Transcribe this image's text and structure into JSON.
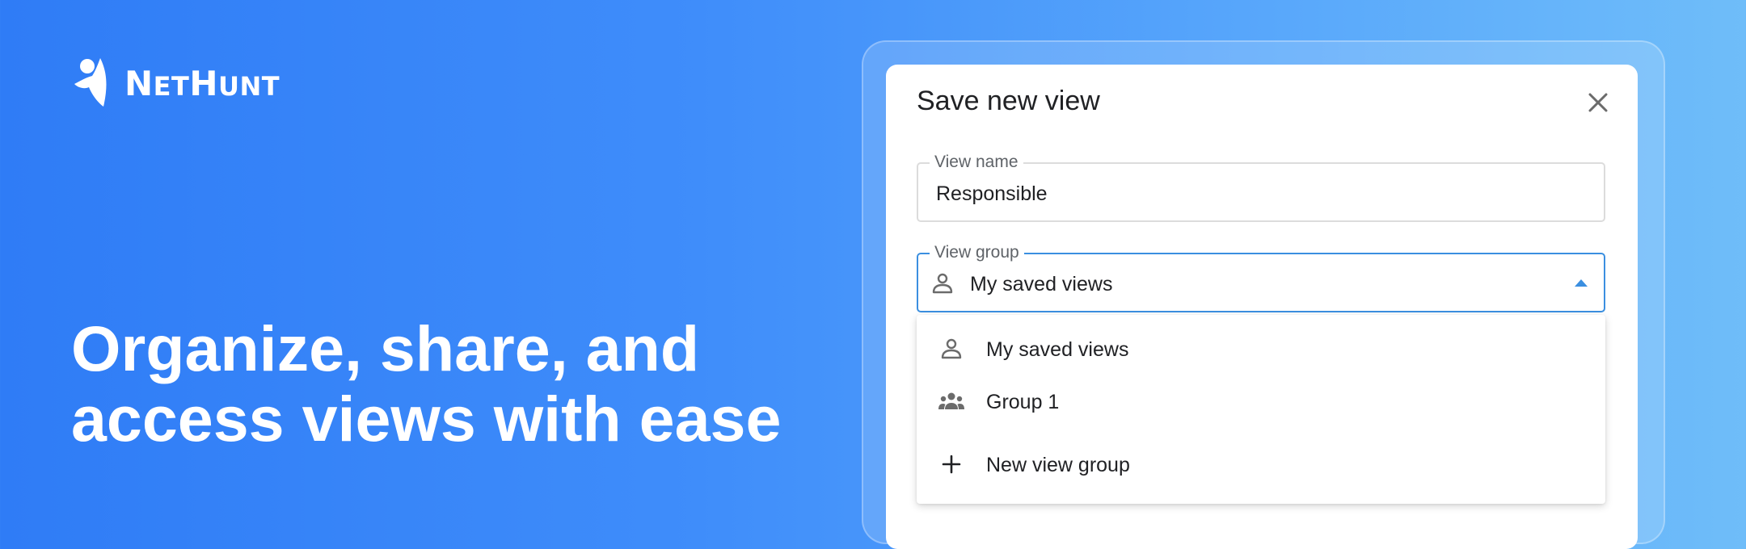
{
  "brand": {
    "name_initial_1": "N",
    "name_rest_1": "ET",
    "name_initial_2": "H",
    "name_rest_2": "UNT"
  },
  "headline": {
    "line1": "Organize, share, and",
    "line2": "access views with ease"
  },
  "dialog": {
    "title": "Save new view",
    "view_name": {
      "label": "View name",
      "value": "Responsible"
    },
    "view_group": {
      "label": "View group",
      "value": "My saved views"
    },
    "menu": [
      {
        "label": "My saved views",
        "icon": "person-icon"
      },
      {
        "label": "Group 1",
        "icon": "group-icon"
      },
      {
        "label": "New view group",
        "icon": "plus-icon"
      }
    ]
  },
  "colors": {
    "gradient_start": "#2f7cf6",
    "gradient_end": "#6fbdf9",
    "focus_border": "#3b8fe0",
    "text": "#202124"
  }
}
